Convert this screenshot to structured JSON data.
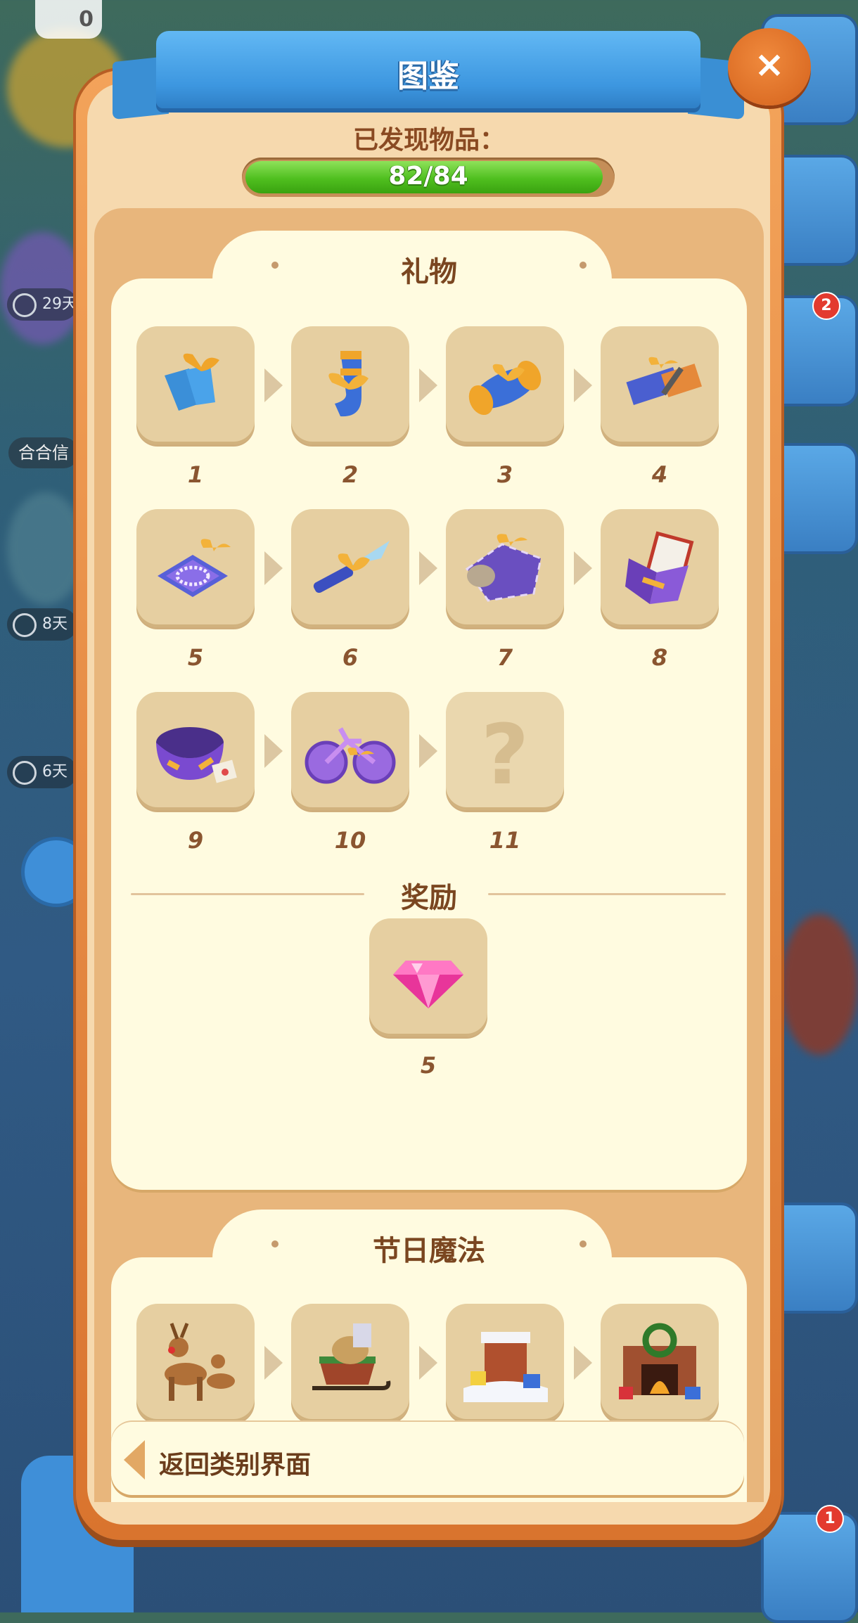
{
  "background": {
    "gem_counter": "0",
    "timers": [
      "29天",
      "8天",
      "6天"
    ],
    "label": "合合信",
    "badges": [
      "2",
      "1"
    ]
  },
  "dialog": {
    "title": "图鉴",
    "close_label": "×",
    "found_label": "已发现物品：",
    "progress": {
      "text": "82/84",
      "found": 82,
      "total": 84
    }
  },
  "gift_card": {
    "title": "礼物",
    "items": [
      {
        "num": "1",
        "icon": "gloves-gift-icon"
      },
      {
        "num": "2",
        "icon": "sock-gift-icon"
      },
      {
        "num": "3",
        "icon": "candy-gift-icon"
      },
      {
        "num": "4",
        "icon": "pen-gift-icon"
      },
      {
        "num": "5",
        "icon": "necklace-box-icon"
      },
      {
        "num": "6",
        "icon": "knife-gift-icon"
      },
      {
        "num": "7",
        "icon": "fish-gift-icon"
      },
      {
        "num": "8",
        "icon": "picture-frame-gift-icon"
      },
      {
        "num": "9",
        "icon": "scarf-gift-icon"
      },
      {
        "num": "10",
        "icon": "bicycle-gift-icon"
      },
      {
        "num": "11",
        "icon": "unknown-item-icon",
        "locked": true
      }
    ],
    "reward": {
      "title": "奖励",
      "amount": "5",
      "icon": "pink-gem-icon"
    }
  },
  "holiday_card": {
    "title": "节日魔法",
    "items": [
      {
        "icon": "reindeer-icon"
      },
      {
        "icon": "sleigh-icon"
      },
      {
        "icon": "chimney-icon"
      },
      {
        "icon": "fireplace-icon"
      }
    ]
  },
  "back_button": {
    "label": "返回类别界面"
  },
  "colors": {
    "panel_orange": "#e58a41",
    "ribbon_blue": "#3d97e0",
    "progress_green": "#4fbf1f",
    "card_cream": "#fffbe0",
    "text_brown": "#7a4620"
  }
}
